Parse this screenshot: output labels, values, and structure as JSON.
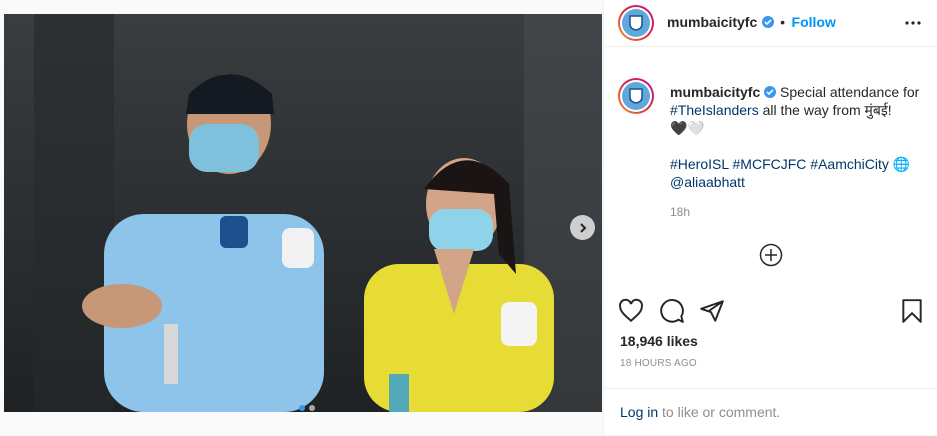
{
  "post": {
    "username": "mumbaicityfc",
    "separator": "•",
    "follow_label": "Follow",
    "caption_text": "Special attendance for",
    "caption_tag1": "#TheIslanders",
    "caption_text2": "all the way from मुंबई!",
    "caption_emoji": "🖤🤍",
    "hashtags": [
      "#HeroISL",
      "#MCFCJFC",
      "#AamchiCity",
      "🌐"
    ],
    "mention": "@aliaabhatt",
    "caption_time": "18h",
    "likes": "18,946 likes",
    "timestamp": "18 HOURS AGO",
    "login_link": "Log in",
    "login_text": "to like or comment."
  },
  "carousel": {
    "total": 2,
    "current": 1
  },
  "colors": {
    "link_blue": "#0095f6",
    "tag_blue": "#00376b",
    "muted": "#8e8e8e"
  },
  "icons": [
    "more-options-icon",
    "verified-badge-icon",
    "add-comment-icon",
    "like-icon",
    "comment-icon",
    "share-icon",
    "save-icon",
    "next-arrow-icon"
  ]
}
